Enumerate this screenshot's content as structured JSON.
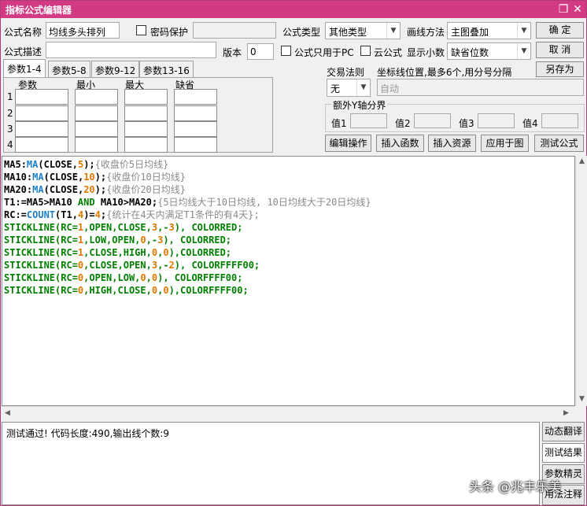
{
  "window": {
    "title": "指标公式编辑器",
    "controls": {
      "restore": "❐",
      "close": "✕"
    },
    "accent": "#d23b84"
  },
  "form": {
    "name_label": "公式名称",
    "name_value": "均线多头排列",
    "password_label": "密码保护",
    "type_label": "公式类型",
    "type_value": "其他类型",
    "draw_label": "画线方法",
    "draw_value": "主图叠加",
    "desc_label": "公式描述",
    "version_label": "版本",
    "version_value": "0",
    "pc_only_label": "公式只用于PC",
    "cloud_label": "云公式",
    "decimals_label": "显示小数",
    "decimals_value": "缺省位数"
  },
  "buttons": {
    "ok": "确  定",
    "cancel": "取  消",
    "save_as": "另存为",
    "edit_op": "编辑操作",
    "insert_func": "插入函数",
    "insert_res": "插入资源",
    "apply": "应用于图",
    "test": "测试公式"
  },
  "tabs": [
    "参数1-4",
    "参数5-8",
    "参数9-12",
    "参数13-16"
  ],
  "params": {
    "headers": [
      "参数",
      "最小",
      "最大",
      "缺省"
    ],
    "rows": [
      "1",
      "2",
      "3",
      "4"
    ]
  },
  "trade": {
    "rule_label": "交易法则",
    "rule_value": "无",
    "axis_hint": "坐标线位置,最多6个,用分号分隔",
    "axis_value": "自动"
  },
  "extra_y": {
    "group_label": "额外Y轴分界",
    "labels": [
      "值1",
      "值2",
      "值3",
      "值4"
    ]
  },
  "code_lines": [
    [
      [
        "v",
        "MA5"
      ],
      [
        "o",
        ":"
      ],
      [
        "f",
        "MA"
      ],
      [
        "o",
        "("
      ],
      [
        "v",
        "CLOSE"
      ],
      [
        "o",
        ","
      ],
      [
        "n",
        "5"
      ],
      [
        "o",
        ");"
      ],
      [
        "c",
        "{收盘价5日均线}"
      ]
    ],
    [
      [
        "v",
        "MA10"
      ],
      [
        "o",
        ":"
      ],
      [
        "f",
        "MA"
      ],
      [
        "o",
        "("
      ],
      [
        "v",
        "CLOSE"
      ],
      [
        "o",
        ","
      ],
      [
        "n",
        "10"
      ],
      [
        "o",
        ");"
      ],
      [
        "c",
        "{收盘价10日均线}"
      ]
    ],
    [
      [
        "v",
        "MA20"
      ],
      [
        "o",
        ":"
      ],
      [
        "f",
        "MA"
      ],
      [
        "o",
        "("
      ],
      [
        "v",
        "CLOSE"
      ],
      [
        "o",
        ","
      ],
      [
        "n",
        "20"
      ],
      [
        "o",
        ");"
      ],
      [
        "c",
        "{收盘价20日均线}"
      ]
    ],
    [
      [
        "v",
        "T1:=MA5>MA10 "
      ],
      [
        "k",
        "AND"
      ],
      [
        "v",
        " MA10>MA20;"
      ],
      [
        "c",
        "{5日均线大于10日均线, 10日均线大于20日均线}"
      ]
    ],
    [
      [
        "v",
        "RC:="
      ],
      [
        "f",
        "COUNT"
      ],
      [
        "o",
        "("
      ],
      [
        "v",
        "T1"
      ],
      [
        "o",
        ","
      ],
      [
        "n",
        "4"
      ],
      [
        "o",
        ")="
      ],
      [
        "n",
        "4"
      ],
      [
        "o",
        ";"
      ],
      [
        "c",
        "{统计在4天内满足T1条件的有4天};"
      ]
    ],
    [
      [
        "g",
        "STICKLINE(RC="
      ],
      [
        "n",
        "1"
      ],
      [
        "g",
        ",OPEN,CLOSE,"
      ],
      [
        "n",
        "3"
      ],
      [
        "g",
        ",-"
      ],
      [
        "n",
        "3"
      ],
      [
        "g",
        "), COLORRED;"
      ]
    ],
    [
      [
        "g",
        "STICKLINE(RC="
      ],
      [
        "n",
        "1"
      ],
      [
        "g",
        ",LOW,OPEN,"
      ],
      [
        "n",
        "0"
      ],
      [
        "g",
        ",-"
      ],
      [
        "n",
        "3"
      ],
      [
        "g",
        "), COLORRED;"
      ]
    ],
    [
      [
        "g",
        "STICKLINE(RC="
      ],
      [
        "n",
        "1"
      ],
      [
        "g",
        ",CLOSE,HIGH,"
      ],
      [
        "n",
        "0"
      ],
      [
        "g",
        ","
      ],
      [
        "n",
        "0"
      ],
      [
        "g",
        "),COLORRED;"
      ]
    ],
    [
      [
        "g",
        "STICKLINE(RC="
      ],
      [
        "n",
        "0"
      ],
      [
        "g",
        ",CLOSE,OPEN,"
      ],
      [
        "n",
        "3"
      ],
      [
        "g",
        ",-"
      ],
      [
        "n",
        "2"
      ],
      [
        "g",
        "), COLORFFFF00;"
      ]
    ],
    [
      [
        "g",
        "STICKLINE(RC="
      ],
      [
        "n",
        "0"
      ],
      [
        "g",
        ",OPEN,LOW,"
      ],
      [
        "n",
        "0"
      ],
      [
        "g",
        ","
      ],
      [
        "n",
        "0"
      ],
      [
        "g",
        "), COLORFFFF00;"
      ]
    ],
    [
      [
        "g",
        "STICKLINE(RC="
      ],
      [
        "n",
        "0"
      ],
      [
        "g",
        ",HIGH,CLOSE,"
      ],
      [
        "n",
        "0"
      ],
      [
        "g",
        ","
      ],
      [
        "n",
        "0"
      ],
      [
        "g",
        "),COLORFFFF00;"
      ]
    ]
  ],
  "syntax_colors": {
    "v": "#000000",
    "o": "#000000",
    "f": "#1e7fc8",
    "n": "#e07800",
    "c": "#8a8a8a",
    "k": "#008000",
    "g": "#008000"
  },
  "output_text": "测试通过! 代码长度:490,输出线个数:9",
  "side_buttons": [
    "动态翻译",
    "测试结果",
    "参数精灵",
    "用法注释"
  ],
  "watermark": "头条 @兆丰乐美"
}
